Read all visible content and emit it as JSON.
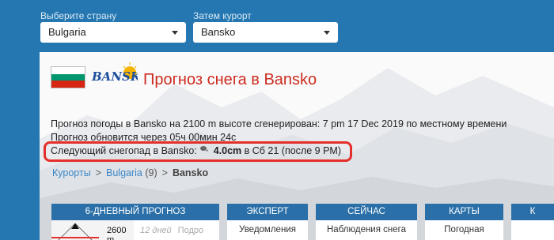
{
  "selectors": {
    "country_label": "Выберите страну",
    "country_value": "Bulgaria",
    "resort_label": "Затем курорт",
    "resort_value": "Bansko"
  },
  "header": {
    "logo_text": "BANSKO",
    "title": "Прогноз снега в Bansko",
    "flag_colors": [
      "#ffffff",
      "#00966e",
      "#d62612"
    ]
  },
  "info": {
    "line1": "Прогноз погоды в Bansko на 2100 m высоте сгенерирован: 7 pm  17 Dec 2019 по местному времени",
    "line2": "Прогноз обновится через 05ч 00мин 24с",
    "snowfall_prefix": "Следующий снегопад в Bansko: ",
    "snowfall_icon": "snow-cloud-icon",
    "snowfall_amount": "4.0cm",
    "snowfall_suffix": " в Сб 21 (после 9 PM)"
  },
  "breadcrumb": {
    "root": "Курорты",
    "country": "Bulgaria",
    "count": " (9)",
    "current": "Bansko"
  },
  "tabs": {
    "forecast_head": "6-дневный прогноз",
    "forecast_elevation": "2600 m",
    "forecast_days": "12 дней",
    "forecast_detail": "Подро",
    "expert_head": "Эксперт",
    "expert_body": "Уведомления",
    "now_head": "Сейчас",
    "now_body": "Наблюдения снега",
    "maps_head": "Карты",
    "maps_body": "Погодная",
    "extra_head": "К"
  },
  "colors": {
    "accent_red": "#e52f2a",
    "title_red": "#cc2b1f",
    "link_blue": "#3a86c8",
    "tab_blue": "#2a6fa8",
    "page_blue": "#2577b1"
  }
}
